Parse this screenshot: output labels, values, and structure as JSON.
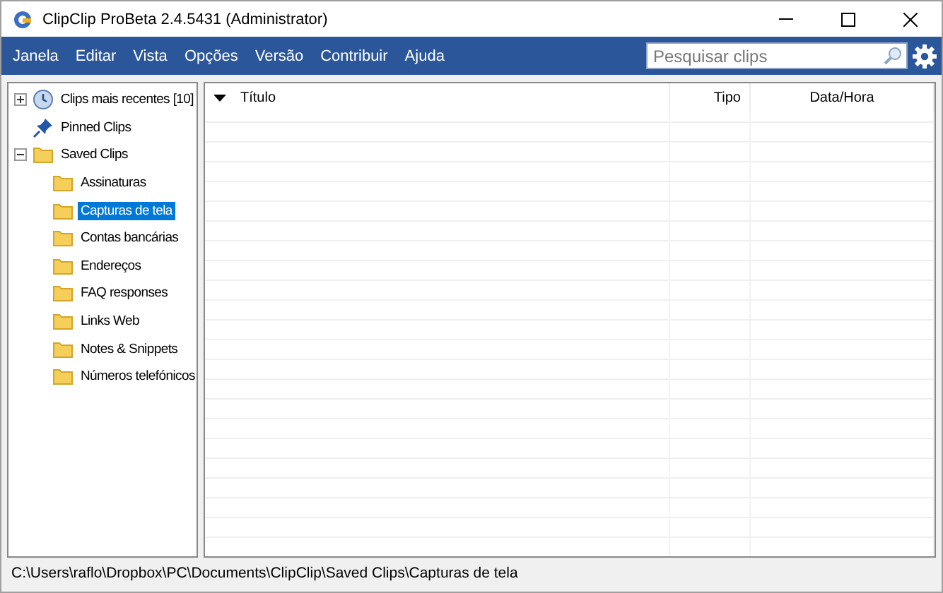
{
  "window": {
    "title": "ClipClip ProBeta 2.4.5431 (Administrator)"
  },
  "menu": [
    "Janela",
    "Editar",
    "Vista",
    "Opções",
    "Versão",
    "Contribuir",
    "Ajuda"
  ],
  "search": {
    "placeholder": "Pesquisar clips"
  },
  "tree": [
    {
      "label": "Clips mais recentes [10]",
      "kind": "recent",
      "expanded": false,
      "selected": false
    },
    {
      "label": "Pinned Clips",
      "kind": "pinned",
      "selected": false
    },
    {
      "label": "Saved Clips",
      "kind": "folder",
      "expanded": true,
      "selected": false,
      "children": [
        {
          "label": "Assinaturas",
          "kind": "folder",
          "selected": false
        },
        {
          "label": "Capturas de tela",
          "kind": "folder",
          "selected": true
        },
        {
          "label": "Contas bancárias",
          "kind": "folder",
          "selected": false
        },
        {
          "label": "Endereços",
          "kind": "folder",
          "selected": false
        },
        {
          "label": "FAQ responses",
          "kind": "folder",
          "selected": false
        },
        {
          "label": "Links Web",
          "kind": "folder",
          "selected": false
        },
        {
          "label": "Notes & Snippets",
          "kind": "folder",
          "selected": false
        },
        {
          "label": "Números telefónicos",
          "kind": "folder",
          "selected": false
        }
      ]
    }
  ],
  "table": {
    "columns": [
      {
        "label": "Título",
        "sorted": true
      },
      {
        "label": "Tipo",
        "sorted": false
      },
      {
        "label": "Data/Hora",
        "sorted": false
      }
    ]
  },
  "status_bar": "C:\\Users\\raflo\\Dropbox\\PC\\Documents\\ClipClip\\Saved Clips\\Capturas de tela"
}
